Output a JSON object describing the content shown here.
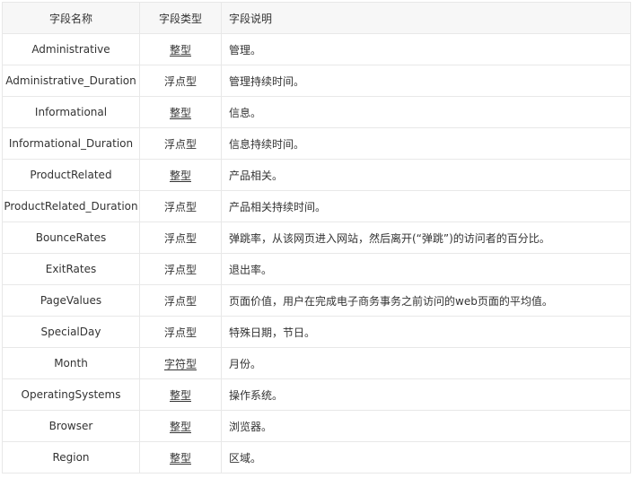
{
  "table": {
    "headers": {
      "name": "字段名称",
      "type": "字段类型",
      "desc": "字段说明"
    },
    "rows": [
      {
        "name": "Administrative",
        "type": "整型",
        "desc": "管理。"
      },
      {
        "name": "Administrative_Duration",
        "type": "浮点型",
        "desc": "管理持续时间。"
      },
      {
        "name": "Informational",
        "type": "整型",
        "desc": "信息。"
      },
      {
        "name": "Informational_Duration",
        "type": "浮点型",
        "desc": "信息持续时间。"
      },
      {
        "name": "ProductRelated",
        "type": "整型",
        "desc": "产品相关。"
      },
      {
        "name": "ProductRelated_Duration",
        "type": "浮点型",
        "desc": "产品相关持续时间。"
      },
      {
        "name": "BounceRates",
        "type": "浮点型",
        "desc": "弹跳率，从该网页进入网站，然后离开(“弹跳”)的访问者的百分比。"
      },
      {
        "name": "ExitRates",
        "type": "浮点型",
        "desc": "退出率。"
      },
      {
        "name": "PageValues",
        "type": "浮点型",
        "desc": "页面价值，用户在完成电子商务事务之前访问的web页面的平均值。"
      },
      {
        "name": "SpecialDay",
        "type": "浮点型",
        "desc": "特殊日期，节日。"
      },
      {
        "name": "Month",
        "type": "字符型",
        "desc": "月份。"
      },
      {
        "name": "OperatingSystems",
        "type": "整型",
        "desc": "操作系统。"
      },
      {
        "name": "Browser",
        "type": "整型",
        "desc": "浏览器。"
      },
      {
        "name": "Region",
        "type": "整型",
        "desc": "区域。"
      }
    ]
  }
}
